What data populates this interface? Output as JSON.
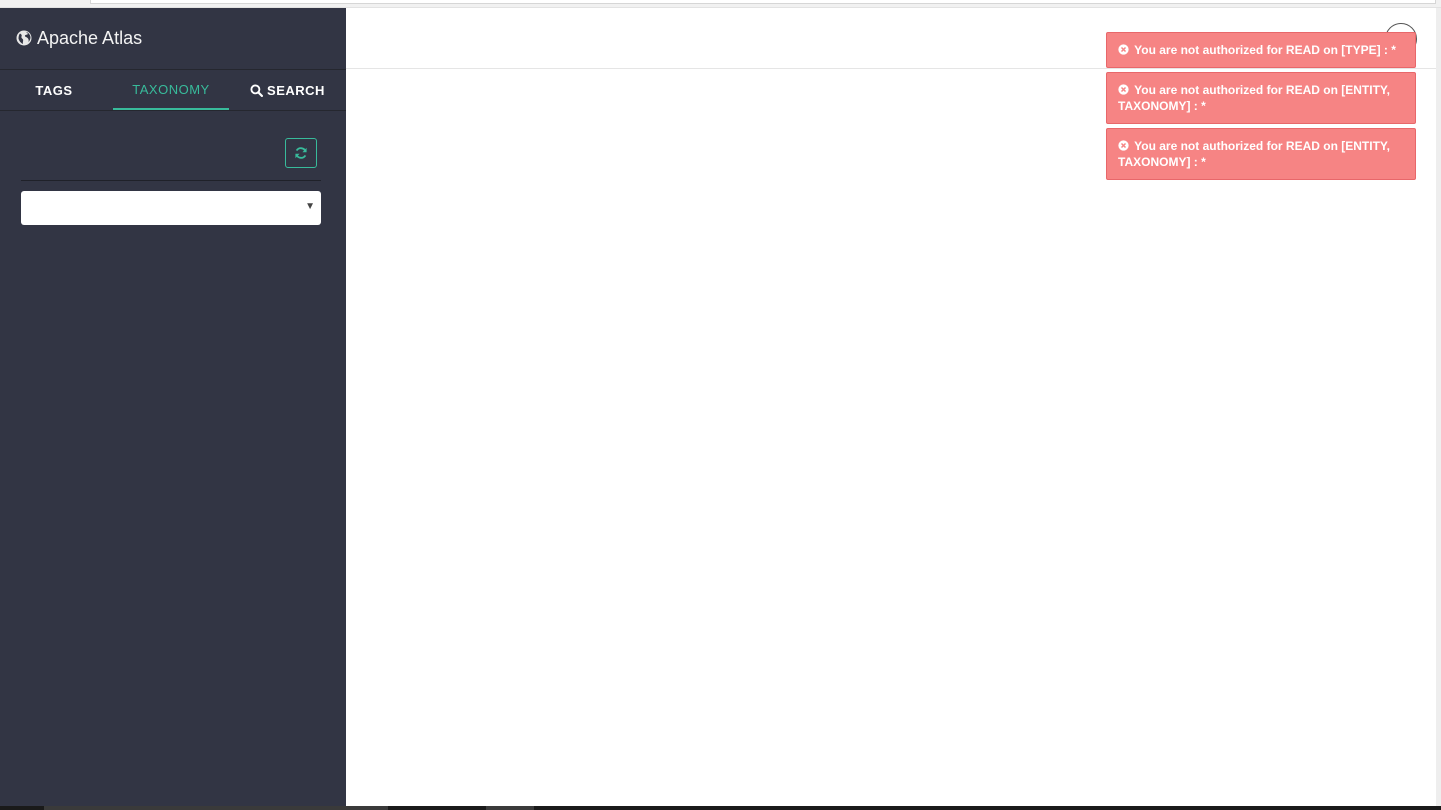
{
  "app": {
    "title": "Apache Atlas",
    "brand_icon": "globe-icon"
  },
  "tabs": [
    {
      "label": "TAGS",
      "active": false
    },
    {
      "label": "TAXONOMY",
      "active": true
    },
    {
      "label": "SEARCH",
      "active": false,
      "icon": "search-icon"
    }
  ],
  "taxonomy_panel": {
    "refresh_icon": "refresh-icon",
    "select_value": ""
  },
  "notifications": [
    {
      "type": "error",
      "icon": "times-circle-icon",
      "message": "You are not authorized for READ on [TYPE] : *"
    },
    {
      "type": "error",
      "icon": "times-circle-icon",
      "message": "You are not authorized for READ on [ENTITY, TAXONOMY] : *"
    },
    {
      "type": "error",
      "icon": "times-circle-icon",
      "message": "You are not authorized for READ on [ENTITY, TAXONOMY] : *"
    }
  ],
  "colors": {
    "sidebar_bg": "#323544",
    "accent": "#38bb9b",
    "toast_error": "#f68484"
  }
}
